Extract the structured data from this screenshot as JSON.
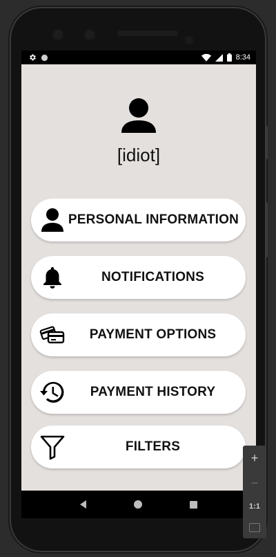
{
  "status_bar": {
    "time": "8:34",
    "left_icons": [
      "gear-icon",
      "circle-icon"
    ],
    "right_icons": [
      "wifi-icon",
      "signal-icon",
      "battery-icon"
    ]
  },
  "profile": {
    "username": "[idiot]",
    "avatar_icon": "user-icon"
  },
  "menu": [
    {
      "label": "PERSONAL INFORMATION",
      "icon": "user-icon"
    },
    {
      "label": "NOTIFICATIONS",
      "icon": "bell-icon"
    },
    {
      "label": "PAYMENT OPTIONS",
      "icon": "credit-cards-icon"
    },
    {
      "label": "PAYMENT HISTORY",
      "icon": "history-icon"
    },
    {
      "label": "FILTERS",
      "icon": "filter-icon"
    }
  ],
  "nav_bar": {
    "buttons": [
      "back-icon",
      "home-icon",
      "recents-icon"
    ]
  },
  "zoom_controls": {
    "zoom_in": "+",
    "zoom_out": "−",
    "ratio": "1:1",
    "fit_icon": "fit-screen-icon"
  },
  "colors": {
    "app_background": "#e4e0de",
    "button_background": "#ffffff",
    "text": "#111111"
  }
}
